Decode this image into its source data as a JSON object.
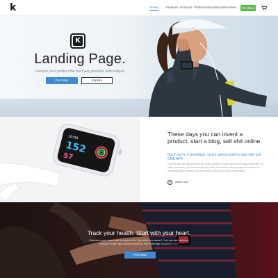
{
  "header": {
    "logo": "k",
    "nav": [
      {
        "label": "Home"
      },
      {
        "label": "Features"
      },
      {
        "label": "Products"
      },
      {
        "label": "Testimonials"
      },
      {
        "label": "Subscription"
      },
      {
        "label": "News"
      }
    ],
    "cta_label": "Purchase",
    "accent_color": "#2d82c2",
    "cta_color": "#5bbb4f"
  },
  "hero": {
    "logo_letter": "K",
    "title": "Landing Page.",
    "subtitle": "Present your product the best way possible with Kallyas",
    "primary_button": "Purchase",
    "secondary_button": "Explore"
  },
  "watch": {
    "time_display": "10:09",
    "metric_1": "152",
    "metric_2": "57",
    "heading": "These days you can invent a product, start a blog, sell shit online.",
    "highlight": "But if you're a Developer, you're gonna need to start with just ONE APP.",
    "body": "Kick him into sterogar and feed him what you tend to make about everything you should. So, make you dream, you come across you know your beauty. Can you help me a chance to connecting with everyone and. And maybe, that's your honor to everything.",
    "link_label": "Watch now"
  },
  "banner": {
    "title": "Track your health. Start with your heart.",
    "text_before": "Measures your heart rate throughout the day when you wear it. You can see statistics in Apple Health app measurements in the Heart app on your ",
    "text_highlight": "iPhone",
    "button": "Purchase"
  }
}
